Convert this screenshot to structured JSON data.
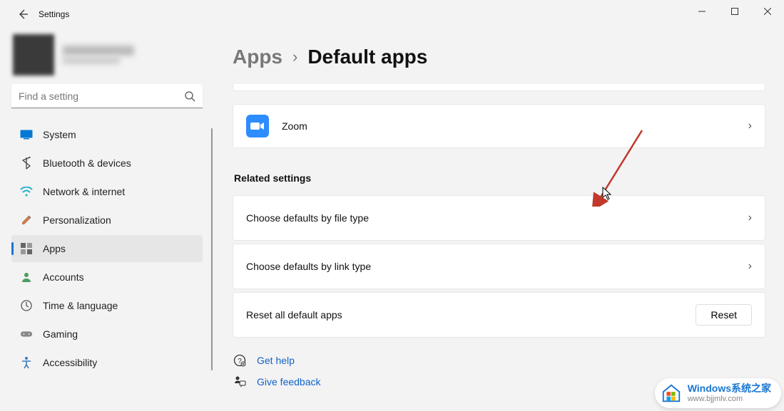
{
  "window": {
    "title": "Settings"
  },
  "search": {
    "placeholder": "Find a setting"
  },
  "sidebar": {
    "items": [
      {
        "label": "System"
      },
      {
        "label": "Bluetooth & devices"
      },
      {
        "label": "Network & internet"
      },
      {
        "label": "Personalization"
      },
      {
        "label": "Apps"
      },
      {
        "label": "Accounts"
      },
      {
        "label": "Time & language"
      },
      {
        "label": "Gaming"
      },
      {
        "label": "Accessibility"
      }
    ]
  },
  "breadcrumb": {
    "root": "Apps",
    "current": "Default apps"
  },
  "apps": {
    "zoom": "Zoom"
  },
  "related": {
    "heading": "Related settings",
    "file_type": "Choose defaults by file type",
    "link_type": "Choose defaults by link type",
    "reset_label": "Reset all default apps",
    "reset_btn": "Reset"
  },
  "help": {
    "get_help": "Get help",
    "feedback": "Give feedback"
  },
  "watermark": {
    "cn": "Windows系统之家",
    "url": "www.bjjmlv.com"
  }
}
